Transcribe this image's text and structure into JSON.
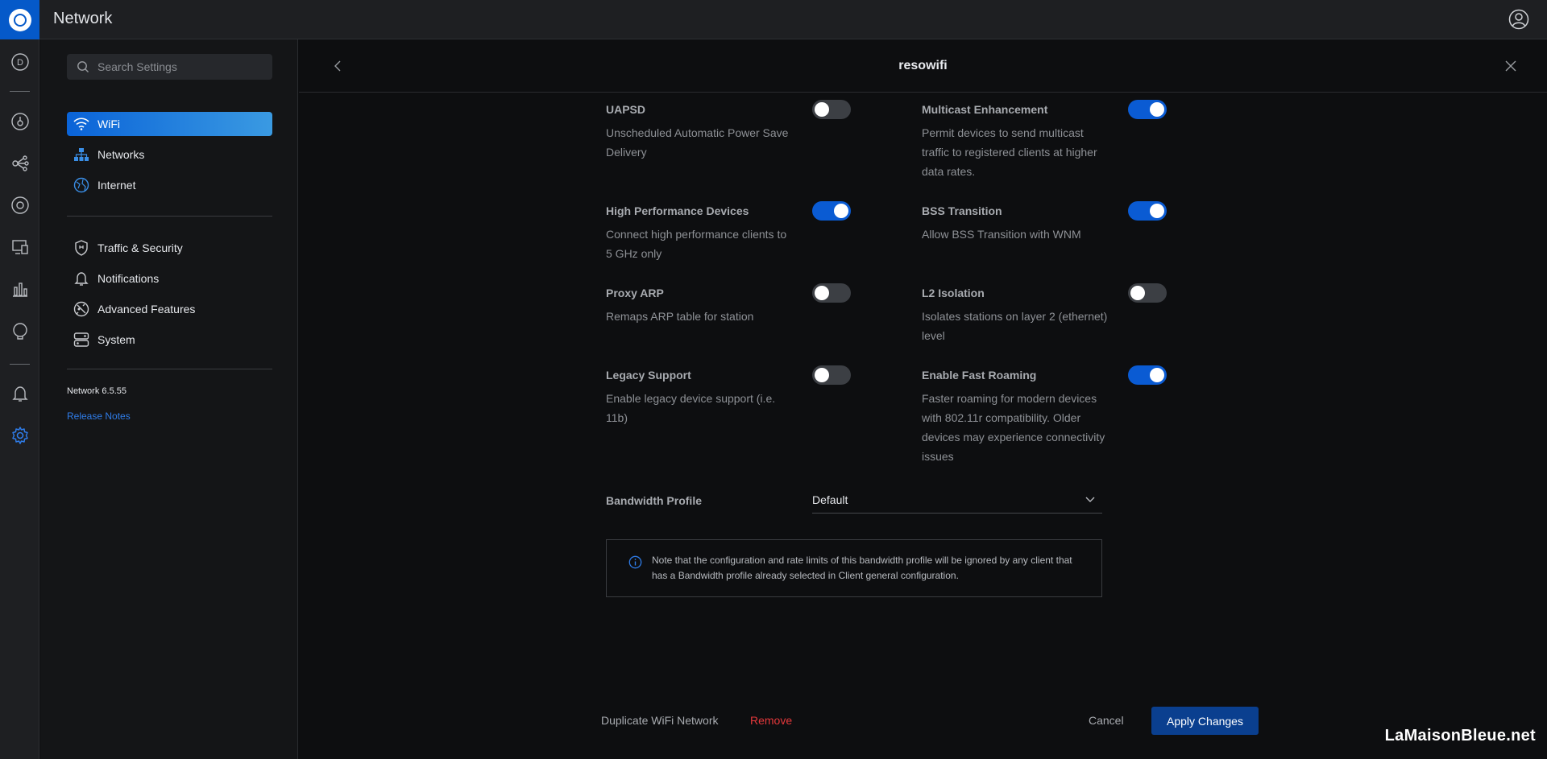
{
  "app": {
    "title": "Network"
  },
  "sidebar": {
    "search_placeholder": "Search Settings",
    "items": [
      {
        "label": "WiFi",
        "icon": "wifi-icon",
        "active": true
      },
      {
        "label": "Networks",
        "icon": "networks-icon"
      },
      {
        "label": "Internet",
        "icon": "globe-icon"
      },
      {
        "label": "Traffic & Security",
        "icon": "shield-icon"
      },
      {
        "label": "Notifications",
        "icon": "bell-icon"
      },
      {
        "label": "Advanced Features",
        "icon": "advanced-features-icon"
      },
      {
        "label": "System",
        "icon": "system-icon"
      }
    ],
    "version": "Network 6.5.55",
    "release_notes": "Release Notes"
  },
  "main": {
    "title": "resowifi",
    "settings": [
      {
        "title": "UAPSD",
        "desc": "Unscheduled Automatic Power Save Delivery",
        "enabled": false
      },
      {
        "title": "Multicast Enhancement",
        "desc": "Permit devices to send multicast traffic to registered clients at higher data rates.",
        "enabled": true
      },
      {
        "title": "High Performance Devices",
        "desc": "Connect high performance clients to 5 GHz only",
        "enabled": true
      },
      {
        "title": "BSS Transition",
        "desc": "Allow BSS Transition with WNM",
        "enabled": true
      },
      {
        "title": "Proxy ARP",
        "desc": "Remaps ARP table for station",
        "enabled": false
      },
      {
        "title": "L2 Isolation",
        "desc": "Isolates stations on layer 2 (ethernet) level",
        "enabled": false
      },
      {
        "title": "Legacy Support",
        "desc": "Enable legacy device support (i.e. 11b)",
        "enabled": false
      },
      {
        "title": "Enable Fast Roaming",
        "desc": "Faster roaming for modern devices with 802.11r compatibility. Older devices may experience connectivity issues",
        "enabled": true
      }
    ],
    "bandwidth_label": "Bandwidth Profile",
    "bandwidth_value": "Default",
    "note": "Note that the configuration and rate limits of this bandwidth profile will be ignored by any client that has a Bandwidth profile already selected in Client general configuration."
  },
  "footer": {
    "duplicate": "Duplicate WiFi Network",
    "remove": "Remove",
    "cancel": "Cancel",
    "apply": "Apply Changes"
  },
  "watermark": "LaMaisonBleue.net",
  "colors": {
    "accent": "#0a5bd3",
    "danger": "#e5383b",
    "link": "#2f7ce8"
  }
}
